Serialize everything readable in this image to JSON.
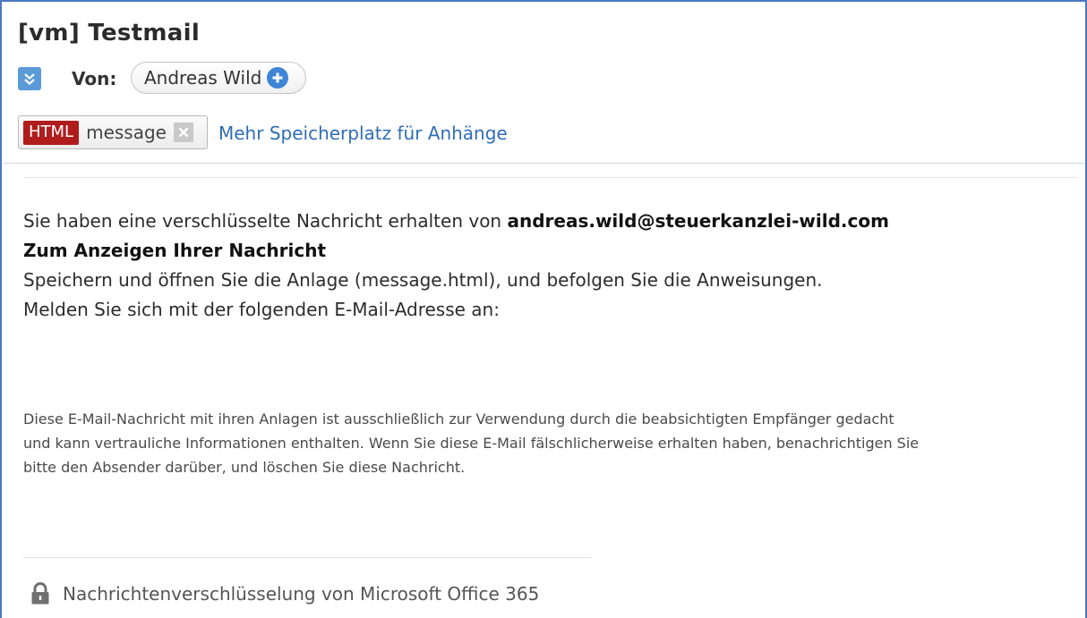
{
  "message": {
    "subject": "[vm] Testmail",
    "from_label": "Von:",
    "sender_name": "Andreas Wild"
  },
  "attachment": {
    "type_badge": "HTML",
    "name": "message",
    "storage_link": "Mehr Speicherplatz für Anhänge"
  },
  "body": {
    "intro_text": "Sie haben eine verschlüsselte Nachricht erhalten von",
    "sender_email": "andreas.wild@steuerkanzlei-wild.com",
    "heading": "Zum Anzeigen Ihrer Nachricht",
    "instruction_1": "Speichern und öffnen Sie die Anlage (message.html), und befolgen Sie die Anweisungen.",
    "instruction_2": "Melden Sie sich mit der folgenden E-Mail-Adresse an:"
  },
  "disclaimer": {
    "line_1": "Diese E-Mail-Nachricht mit ihren Anlagen ist ausschließlich zur Verwendung durch die beabsichtigten Empfänger gedacht",
    "line_2": "und kann vertrauliche Informationen enthalten. Wenn Sie diese E-Mail fälschlicherweise erhalten haben, benachrichtigen Sie",
    "line_3": "bitte den Absender darüber, und löschen Sie diese Nachricht."
  },
  "footer": {
    "text": "Nachrichtenverschlüsselung von Microsoft Office 365"
  },
  "icons": {
    "expand": "expand-icon",
    "add_contact": "add-contact-icon",
    "remove_attachment": "close-icon",
    "lock": "lock-icon"
  },
  "colors": {
    "frame_border": "#4a78c2",
    "html_badge": "#b01c1c",
    "link": "#2f6db5",
    "expand_icon": "#5b9bd8",
    "add_contact_icon": "#3f85d6"
  }
}
